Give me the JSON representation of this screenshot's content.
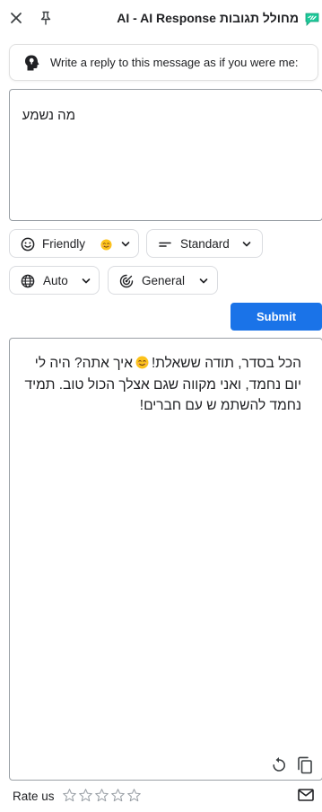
{
  "header": {
    "title": "AI - AI Response מחולל תגובות",
    "close_icon": "close-icon",
    "pin_icon": "pin-icon",
    "logo_icon": "reply-logo-icon",
    "logo_color": "#1ec99a"
  },
  "prompt": {
    "icon": "lightbulb-head-icon",
    "text": "Write a reply to this message as if you were me:"
  },
  "input": {
    "value": "מה נשמע"
  },
  "options": {
    "tone": {
      "label": "Friendly",
      "icon": "smiley-icon",
      "emoji": "smiling-face-emoji"
    },
    "length": {
      "label": "Standard",
      "icon": "short-text-icon"
    },
    "language": {
      "label": "Auto",
      "icon": "globe-icon"
    },
    "context": {
      "label": "General",
      "icon": "target-icon"
    }
  },
  "submit": {
    "label": "Submit",
    "color": "#1a73e8"
  },
  "output": {
    "line1_before": "הכל בסדר, תודה ששאלת!",
    "line1_after": "איך אתה? היה לי",
    "line2": "יום נחמד, ואני מקווה שגם אצלך הכול טוב. תמיד",
    "line3": "נחמד להשתמ ש עם חברים!",
    "refresh_icon": "refresh-icon",
    "copy_icon": "copy-icon"
  },
  "footer": {
    "rate_label": "Rate us",
    "stars_total": 5,
    "stars_filled": 0,
    "mail_icon": "mail-icon"
  }
}
